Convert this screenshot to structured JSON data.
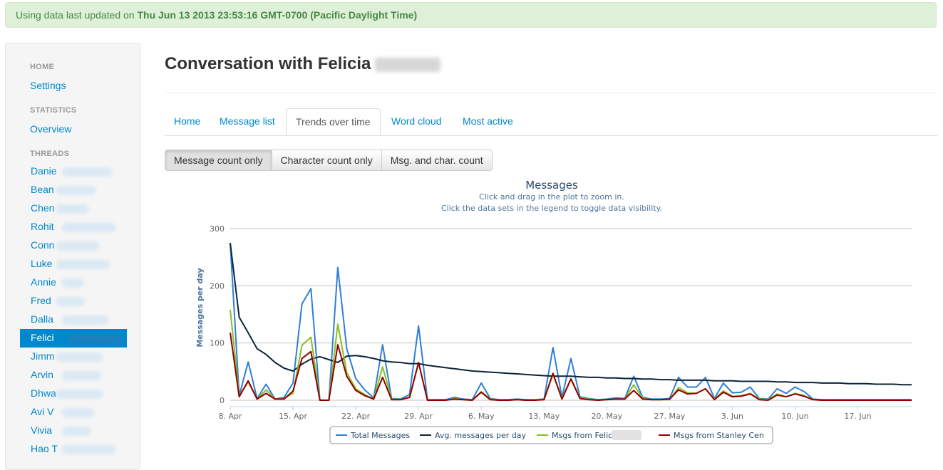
{
  "alert": {
    "prefix": "Using data last updated on ",
    "timestamp": "Thu Jun 13 2013 23:53:16 GMT-0700 (Pacific Daylight Time)"
  },
  "sidebar": {
    "home_header": "HOME",
    "settings": "Settings",
    "stats_header": "STATISTICS",
    "overview": "Overview",
    "threads_header": "THREADS",
    "threads": [
      {
        "name": "Danie"
      },
      {
        "name": "Bean"
      },
      {
        "name": "Chen"
      },
      {
        "name": "Rohit"
      },
      {
        "name": "Conn"
      },
      {
        "name": "Luke"
      },
      {
        "name": "Annie"
      },
      {
        "name": "Fred"
      },
      {
        "name": "Dalla"
      },
      {
        "name": "Felici"
      },
      {
        "name": "Jimm"
      },
      {
        "name": "Arvin"
      },
      {
        "name": "Dhwa"
      },
      {
        "name": "Avi V"
      },
      {
        "name": "Vivia"
      },
      {
        "name": "Hao T"
      }
    ],
    "active_thread": "Felici"
  },
  "page": {
    "title": "Conversation with Felicia"
  },
  "tabs": [
    "Home",
    "Message list",
    "Trends over time",
    "Word cloud",
    "Most active"
  ],
  "active_tab": "Trends over time",
  "buttons": [
    "Message count only",
    "Character count only",
    "Msg. and char. count"
  ],
  "active_button": "Message count only",
  "chart_data": {
    "type": "line",
    "title": "Messages",
    "subtitle_1": "Click and drag in the plot to zoom in.",
    "subtitle_2": "Click the data sets in the legend to toggle data visibility.",
    "ylabel": "Messages per day",
    "ylim": [
      0,
      300
    ],
    "y_ticks": [
      0,
      100,
      200,
      300
    ],
    "x_ticks": [
      "8. Apr",
      "15. Apr",
      "22. Apr",
      "29. Apr",
      "6. May",
      "13. May",
      "20. May",
      "27. May",
      "3. Jun",
      "10. Jun",
      "17. Jun"
    ],
    "x_start": "2013-04-08",
    "grid": true,
    "legend_position": "bottom-center",
    "series": [
      {
        "name": "Total Messages",
        "color": "#2f7ed8",
        "values": [
          275,
          8,
          67,
          3,
          28,
          2,
          5,
          30,
          168,
          195,
          0,
          0,
          232,
          90,
          38,
          18,
          4,
          97,
          3,
          2,
          10,
          130,
          1,
          1,
          1,
          5,
          2,
          1,
          30,
          3,
          1,
          1,
          2,
          1,
          1,
          2,
          92,
          5,
          73,
          6,
          3,
          1,
          2,
          4,
          3,
          42,
          5,
          2,
          2,
          3,
          40,
          23,
          23,
          40,
          3,
          30,
          13,
          14,
          23,
          3,
          2,
          20,
          12,
          23,
          15,
          2,
          1,
          1,
          1,
          1,
          1,
          1,
          1,
          1,
          1,
          1,
          1
        ]
      },
      {
        "name": "Avg. messages per day",
        "color": "#0d233a",
        "values": [
          275,
          145,
          118,
          90,
          80,
          66,
          56,
          51,
          63,
          72,
          76,
          71,
          66,
          77,
          78,
          76,
          73,
          69,
          67,
          66,
          64,
          64,
          61,
          59,
          57,
          55,
          53,
          51,
          50,
          49,
          48,
          47,
          46,
          45,
          44,
          43,
          42,
          42,
          42,
          41,
          40,
          40,
          39,
          39,
          38,
          38,
          37,
          37,
          36,
          36,
          35,
          35,
          35,
          35,
          34,
          34,
          34,
          33,
          33,
          33,
          33,
          32,
          32,
          31,
          31,
          31,
          30,
          30,
          30,
          29,
          29,
          29,
          28,
          28,
          28,
          27,
          27
        ]
      },
      {
        "name": "Msgs from Felicia",
        "color": "#8bbc21",
        "values": [
          158,
          8,
          32,
          2,
          18,
          2,
          3,
          12,
          96,
          110,
          0,
          0,
          133,
          48,
          20,
          10,
          2,
          58,
          2,
          1,
          5,
          65,
          1,
          0,
          0,
          3,
          1,
          0,
          15,
          2,
          0,
          0,
          1,
          0,
          1,
          1,
          45,
          3,
          38,
          4,
          2,
          0,
          1,
          2,
          2,
          27,
          3,
          1,
          1,
          1,
          22,
          13,
          12,
          20,
          2,
          16,
          7,
          8,
          12,
          2,
          1,
          11,
          6,
          12,
          8,
          1,
          0,
          0,
          0,
          0,
          0,
          0,
          0,
          0,
          0,
          0,
          0
        ]
      },
      {
        "name": "Msgs from Stanley Cen",
        "color": "#910000",
        "values": [
          118,
          6,
          34,
          2,
          12,
          2,
          2,
          16,
          73,
          85,
          0,
          0,
          97,
          42,
          17,
          8,
          2,
          40,
          1,
          1,
          5,
          66,
          0,
          0,
          0,
          2,
          1,
          0,
          14,
          1,
          0,
          0,
          1,
          0,
          0,
          1,
          47,
          2,
          37,
          3,
          1,
          0,
          1,
          2,
          2,
          17,
          2,
          1,
          1,
          2,
          18,
          11,
          12,
          20,
          1,
          14,
          6,
          7,
          11,
          1,
          0,
          9,
          6,
          11,
          7,
          1,
          0,
          0,
          0,
          0,
          0,
          0,
          0,
          0,
          0,
          0,
          0
        ]
      }
    ]
  }
}
